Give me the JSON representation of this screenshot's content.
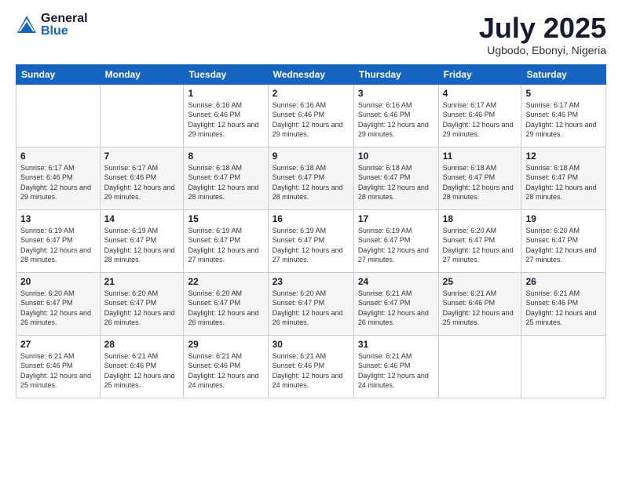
{
  "header": {
    "logo_general": "General",
    "logo_blue": "Blue",
    "month_year": "July 2025",
    "location": "Ugbodo, Ebonyi, Nigeria"
  },
  "weekdays": [
    "Sunday",
    "Monday",
    "Tuesday",
    "Wednesday",
    "Thursday",
    "Friday",
    "Saturday"
  ],
  "weeks": [
    [
      {
        "day": "",
        "info": ""
      },
      {
        "day": "",
        "info": ""
      },
      {
        "day": "1",
        "info": "Sunrise: 6:16 AM\nSunset: 6:46 PM\nDaylight: 12 hours and 29 minutes."
      },
      {
        "day": "2",
        "info": "Sunrise: 6:16 AM\nSunset: 6:46 PM\nDaylight: 12 hours and 29 minutes."
      },
      {
        "day": "3",
        "info": "Sunrise: 6:16 AM\nSunset: 6:46 PM\nDaylight: 12 hours and 29 minutes."
      },
      {
        "day": "4",
        "info": "Sunrise: 6:17 AM\nSunset: 6:46 PM\nDaylight: 12 hours and 29 minutes."
      },
      {
        "day": "5",
        "info": "Sunrise: 6:17 AM\nSunset: 6:46 PM\nDaylight: 12 hours and 29 minutes."
      }
    ],
    [
      {
        "day": "6",
        "info": "Sunrise: 6:17 AM\nSunset: 6:46 PM\nDaylight: 12 hours and 29 minutes."
      },
      {
        "day": "7",
        "info": "Sunrise: 6:17 AM\nSunset: 6:46 PM\nDaylight: 12 hours and 29 minutes."
      },
      {
        "day": "8",
        "info": "Sunrise: 6:18 AM\nSunset: 6:47 PM\nDaylight: 12 hours and 28 minutes."
      },
      {
        "day": "9",
        "info": "Sunrise: 6:18 AM\nSunset: 6:47 PM\nDaylight: 12 hours and 28 minutes."
      },
      {
        "day": "10",
        "info": "Sunrise: 6:18 AM\nSunset: 6:47 PM\nDaylight: 12 hours and 28 minutes."
      },
      {
        "day": "11",
        "info": "Sunrise: 6:18 AM\nSunset: 6:47 PM\nDaylight: 12 hours and 28 minutes."
      },
      {
        "day": "12",
        "info": "Sunrise: 6:18 AM\nSunset: 6:47 PM\nDaylight: 12 hours and 28 minutes."
      }
    ],
    [
      {
        "day": "13",
        "info": "Sunrise: 6:19 AM\nSunset: 6:47 PM\nDaylight: 12 hours and 28 minutes."
      },
      {
        "day": "14",
        "info": "Sunrise: 6:19 AM\nSunset: 6:47 PM\nDaylight: 12 hours and 28 minutes."
      },
      {
        "day": "15",
        "info": "Sunrise: 6:19 AM\nSunset: 6:47 PM\nDaylight: 12 hours and 27 minutes."
      },
      {
        "day": "16",
        "info": "Sunrise: 6:19 AM\nSunset: 6:47 PM\nDaylight: 12 hours and 27 minutes."
      },
      {
        "day": "17",
        "info": "Sunrise: 6:19 AM\nSunset: 6:47 PM\nDaylight: 12 hours and 27 minutes."
      },
      {
        "day": "18",
        "info": "Sunrise: 6:20 AM\nSunset: 6:47 PM\nDaylight: 12 hours and 27 minutes."
      },
      {
        "day": "19",
        "info": "Sunrise: 6:20 AM\nSunset: 6:47 PM\nDaylight: 12 hours and 27 minutes."
      }
    ],
    [
      {
        "day": "20",
        "info": "Sunrise: 6:20 AM\nSunset: 6:47 PM\nDaylight: 12 hours and 26 minutes."
      },
      {
        "day": "21",
        "info": "Sunrise: 6:20 AM\nSunset: 6:47 PM\nDaylight: 12 hours and 26 minutes."
      },
      {
        "day": "22",
        "info": "Sunrise: 6:20 AM\nSunset: 6:47 PM\nDaylight: 12 hours and 26 minutes."
      },
      {
        "day": "23",
        "info": "Sunrise: 6:20 AM\nSunset: 6:47 PM\nDaylight: 12 hours and 26 minutes."
      },
      {
        "day": "24",
        "info": "Sunrise: 6:21 AM\nSunset: 6:47 PM\nDaylight: 12 hours and 26 minutes."
      },
      {
        "day": "25",
        "info": "Sunrise: 6:21 AM\nSunset: 6:46 PM\nDaylight: 12 hours and 25 minutes."
      },
      {
        "day": "26",
        "info": "Sunrise: 6:21 AM\nSunset: 6:46 PM\nDaylight: 12 hours and 25 minutes."
      }
    ],
    [
      {
        "day": "27",
        "info": "Sunrise: 6:21 AM\nSunset: 6:46 PM\nDaylight: 12 hours and 25 minutes."
      },
      {
        "day": "28",
        "info": "Sunrise: 6:21 AM\nSunset: 6:46 PM\nDaylight: 12 hours and 25 minutes."
      },
      {
        "day": "29",
        "info": "Sunrise: 6:21 AM\nSunset: 6:46 PM\nDaylight: 12 hours and 24 minutes."
      },
      {
        "day": "30",
        "info": "Sunrise: 6:21 AM\nSunset: 6:46 PM\nDaylight: 12 hours and 24 minutes."
      },
      {
        "day": "31",
        "info": "Sunrise: 6:21 AM\nSunset: 6:46 PM\nDaylight: 12 hours and 24 minutes."
      },
      {
        "day": "",
        "info": ""
      },
      {
        "day": "",
        "info": ""
      }
    ]
  ]
}
